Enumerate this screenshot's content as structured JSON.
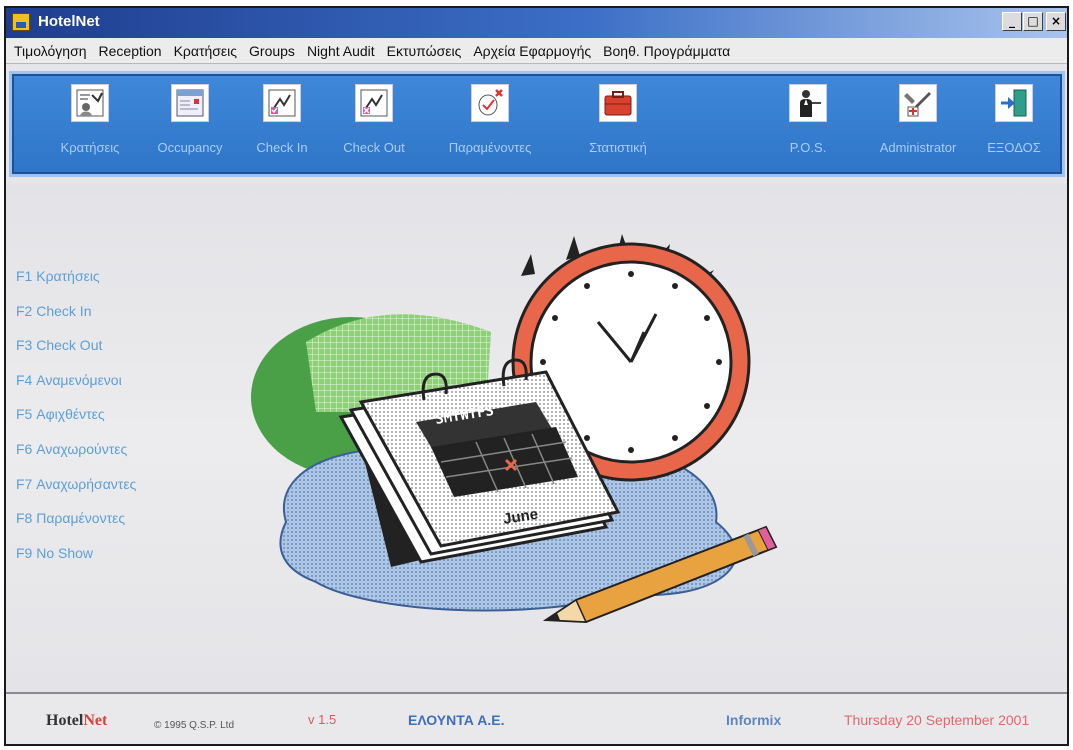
{
  "window": {
    "title": "HotelNet",
    "controls": {
      "minimize": "_",
      "maximize": "□",
      "close": "×"
    }
  },
  "menu": [
    {
      "label": "Τιμολόγηση"
    },
    {
      "label": "Reception"
    },
    {
      "label": "Κρατήσεις"
    },
    {
      "label": "Groups"
    },
    {
      "label": "Night Audit"
    },
    {
      "label": "Εκτυπώσεις"
    },
    {
      "label": "Αρχεία Εφαρμογής"
    },
    {
      "label": "Βοηθ. Προγράμματα"
    }
  ],
  "toolbar": [
    {
      "label": "Κρατήσεις",
      "icon": "reservations-icon"
    },
    {
      "label": "Occupancy",
      "icon": "occupancy-icon"
    },
    {
      "label": "Check In",
      "icon": "check-in-icon"
    },
    {
      "label": "Check Out",
      "icon": "check-out-icon"
    },
    {
      "label": "Παραμένοντες",
      "icon": "staying-guests-icon"
    },
    {
      "label": "Στατιστική",
      "icon": "statistics-briefcase-icon"
    },
    {
      "label": "P.O.S.",
      "icon": "pos-waiter-icon"
    },
    {
      "label": "Administrator",
      "icon": "administrator-tools-icon"
    },
    {
      "label": "ΕΞΟΔΟΣ",
      "icon": "exit-door-icon"
    }
  ],
  "shortcuts": [
    {
      "label": "F1 Κρατήσεις"
    },
    {
      "label": "F2 Check In"
    },
    {
      "label": "F3 Check Out"
    },
    {
      "label": "F4 Αναμενόμενοι"
    },
    {
      "label": "F5 Αφιχθέντες"
    },
    {
      "label": "F6 Αναχωρούντες"
    },
    {
      "label": "F7 Αναχωρήσαντες"
    },
    {
      "label": "F8 Παραμένοντες"
    },
    {
      "label": "F9 No Show"
    }
  ],
  "illustration": {
    "calendar_days": "SMTWTFS",
    "calendar_month": "June"
  },
  "status": {
    "brand_a": "Hotel",
    "brand_b": "Net",
    "copyright": "© 1995 Q.S.P. Ltd",
    "version": "v 1.5",
    "company": "ΕΛΟΥΝΤΑ Α.Ε.",
    "database": "Informix",
    "date": "Thursday 20 September 2001"
  },
  "colors": {
    "toolbar_bg": "#2f76c8",
    "shortcut_text": "#5b9fd6",
    "date_text": "#e06868",
    "clock_rim": "#e8664a"
  }
}
